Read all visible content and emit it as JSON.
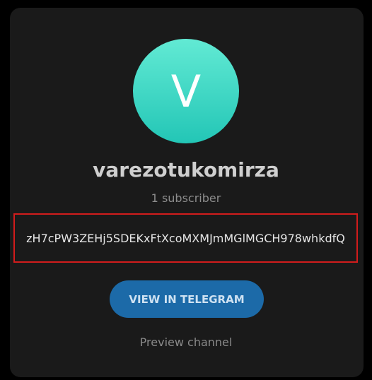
{
  "channel": {
    "avatar_letter": "V",
    "name": "varezotukomirza",
    "subscribers": "1 subscriber",
    "description": "zH7cPW3ZEHj5SDEKxFtXcoMXMJmMGlMGCH978whkdfQ"
  },
  "actions": {
    "view_label": "VIEW IN TELEGRAM",
    "preview_label": "Preview channel"
  },
  "colors": {
    "avatar_gradient_top": "#62ead4",
    "avatar_gradient_bottom": "#23c6b6",
    "button_bg": "#1c6aa8",
    "highlight_border": "#d21c1c"
  }
}
